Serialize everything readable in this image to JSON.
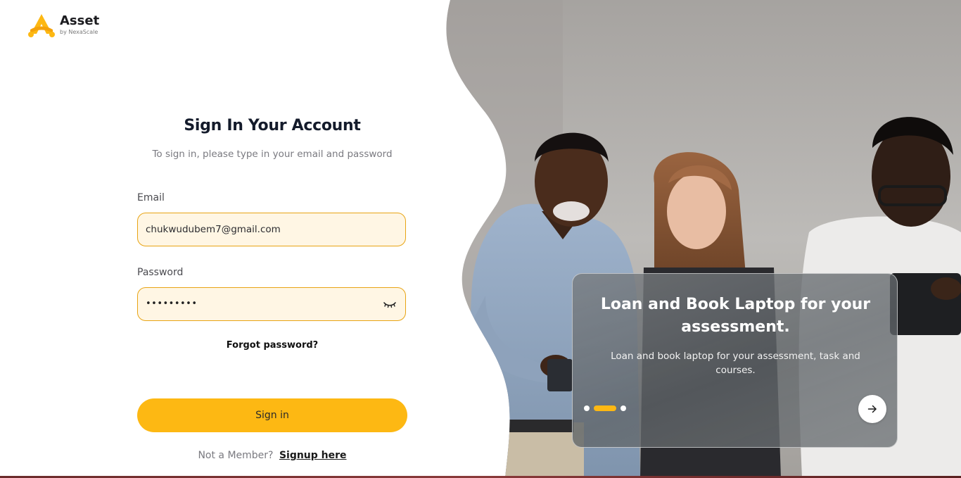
{
  "brand": {
    "name": "Asset",
    "tagline": "by NexaScale",
    "accent_color": "#fdb813"
  },
  "form": {
    "title": "Sign In Your Account",
    "subtitle": "To sign in, please type in your email and password",
    "email_label": "Email",
    "email_value": "chukwudubem7@gmail.com",
    "password_label": "Password",
    "password_value": "•••••••••",
    "password_toggle_icon": "eye-closed-icon",
    "forgot_label": "Forgot password?",
    "submit_label": "Sign in",
    "member_prompt": "Not a Member?",
    "signup_label": "Signup here"
  },
  "promo": {
    "title": "Loan and Book Laptop for your assessment.",
    "description": "Loan and book laptop for your assessment, task and courses.",
    "slides_total": 3,
    "active_slide": 2,
    "next_icon": "arrow-right-icon"
  }
}
